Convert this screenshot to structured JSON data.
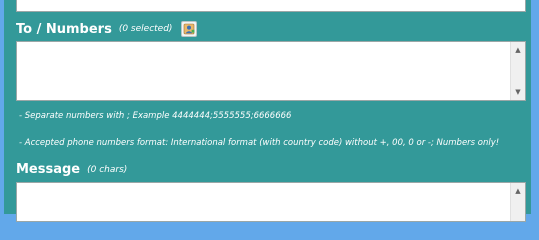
{
  "to_section": {
    "label": "To / Numbers",
    "selected_count": "(0 selected)",
    "contacts_icon": "contacts-book-icon",
    "numbers_value": ""
  },
  "hints": {
    "separator": " - Separate numbers with ;  Example 4444444;5555555;6666666",
    "format": " - Accepted phone numbers format: International format (with country code) without +, 00, 0 or -; Numbers only!"
  },
  "message_section": {
    "label": "Message",
    "char_count": "(0 chars)",
    "message_value": ""
  },
  "scroll": {
    "up_arrow": "▲",
    "down_arrow": "▼"
  },
  "colors": {
    "panel_background": "#339999",
    "page_background": "#62a8ea",
    "text": "#ffffff"
  }
}
